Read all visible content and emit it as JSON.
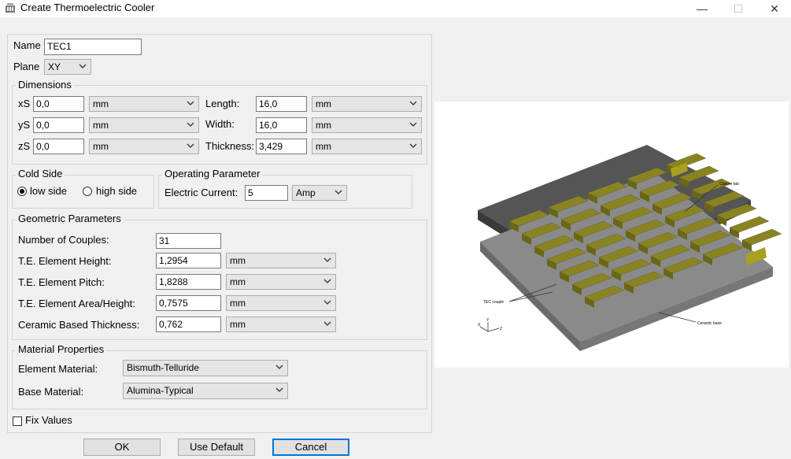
{
  "window": {
    "title": "Create Thermoelectric Cooler",
    "minimize": "—",
    "maximize": "☐",
    "close": "✕"
  },
  "name": {
    "label": "Name",
    "value": "TEC1"
  },
  "plane": {
    "label": "Plane",
    "value": "XY"
  },
  "dimensions": {
    "group_label": "Dimensions",
    "rows": [
      {
        "label": "xS",
        "value": "0,0",
        "unit": "mm",
        "label2": "Length:",
        "value2": "16,0",
        "unit2": "mm"
      },
      {
        "label": "yS",
        "value": "0,0",
        "unit": "mm",
        "label2": "Width:",
        "value2": "16,0",
        "unit2": "mm"
      },
      {
        "label": "zS",
        "value": "0,0",
        "unit": "mm",
        "label2": "Thickness:",
        "value2": "3,429",
        "unit2": "mm"
      }
    ]
  },
  "cold_side": {
    "group_label": "Cold Side",
    "low_label": "low side",
    "high_label": "high side",
    "selected": "low side"
  },
  "operating": {
    "group_label": "Operating Parameter",
    "label": "Electric Current:",
    "value": "5",
    "unit": "Amp"
  },
  "geometric": {
    "group_label": "Geometric Parameters",
    "couples_label": "Number of Couples:",
    "couples_value": "31",
    "rows": [
      {
        "label": "T.E. Element Height:",
        "value": "1,2954",
        "unit": "mm"
      },
      {
        "label": "T.E. Element Pitch:",
        "value": "1,8288",
        "unit": "mm"
      },
      {
        "label": "T.E. Element Area/Height:",
        "value": "0,7575",
        "unit": "mm"
      },
      {
        "label": "Ceramic Based Thickness:",
        "value": "0,762",
        "unit": "mm"
      }
    ]
  },
  "material": {
    "group_label": "Material Properties",
    "element_label": "Element Material:",
    "element_value": "Bismuth-Telluride",
    "base_label": "Base Material:",
    "base_value": "Alumina-Typical"
  },
  "fix_values": {
    "label": "Fix Values",
    "checked": false
  },
  "buttons": {
    "ok": "OK",
    "use_default": "Use Default",
    "cancel": "Cancel"
  },
  "preview": {
    "annotations": {
      "copper_tab": "Copper tab",
      "tec_couple": "TEC couple",
      "ceramic_base": "Ceramic base"
    },
    "axis": {
      "x": "X",
      "y": "Y",
      "z": "Z"
    }
  }
}
